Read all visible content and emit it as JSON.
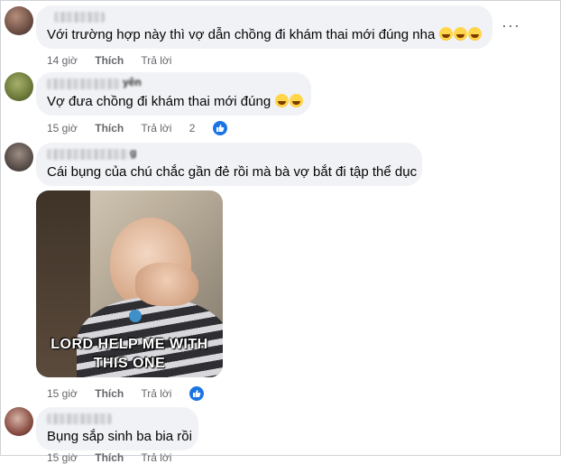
{
  "comments": [
    {
      "name_suffix": "",
      "text": "Với trường hợp này thì vợ dẫn chồng đi khám thai mới đúng nha",
      "emoji": [
        "laughing-emoji",
        "rofl-emoji",
        "rofl-emoji"
      ],
      "time": "14 giờ",
      "like_label": "Thích",
      "reply_label": "Trả lời",
      "reaction_count": "",
      "more_label": "···"
    },
    {
      "name_suffix": "yên",
      "text": "Vợ đưa chồng đi khám thai mới đúng",
      "emoji": [
        "rofl-emoji",
        "rofl-emoji"
      ],
      "time": "15 giờ",
      "like_label": "Thích",
      "reply_label": "Trả lời",
      "reaction_count": "2"
    },
    {
      "name_suffix": "g",
      "text": "Cái bụng của chú chắc gần đẻ rồi mà bà vợ bắt đi tập thể dục",
      "gif_caption_line1": "LORD HELP ME WITH",
      "gif_caption_line2": "THIS ONE",
      "time": "15 giờ",
      "like_label": "Thích",
      "reply_label": "Trả lời",
      "reaction_count": ""
    },
    {
      "name_suffix": "",
      "text": "Bụng sắp sinh ba bia rồi",
      "time": "15 giờ",
      "like_label": "Thích",
      "reply_label": "Trả lời"
    }
  ],
  "colors": {
    "bubble": "#f0f2f5",
    "meta_text": "#65676b",
    "like_blue": "#1b74e4"
  }
}
